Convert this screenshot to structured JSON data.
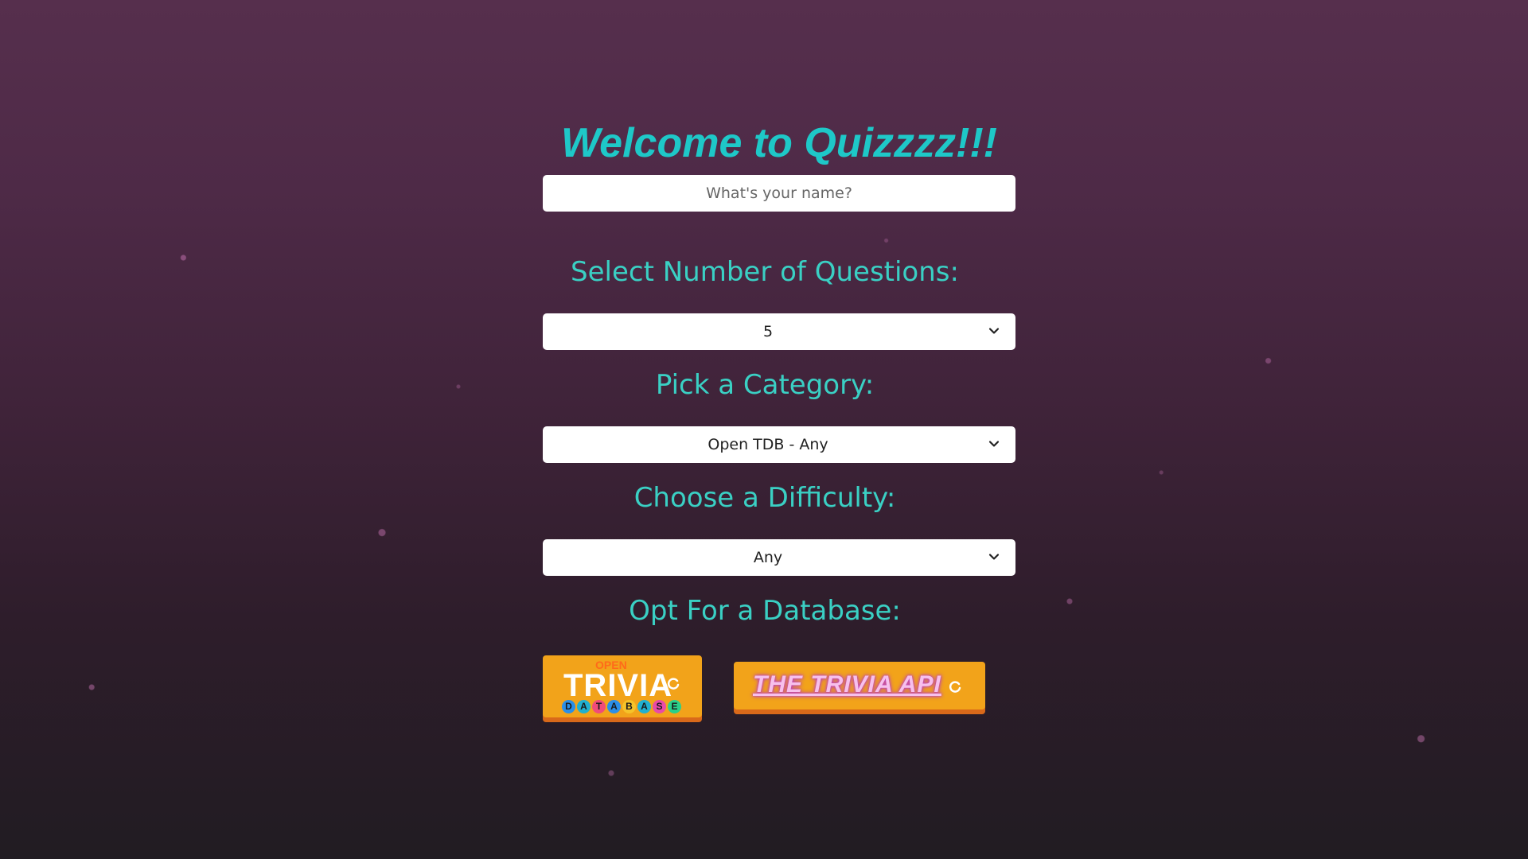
{
  "title": "Welcome to Quizzzz!!!",
  "name_input": {
    "placeholder": "What's your name?",
    "value": ""
  },
  "questions": {
    "label": "Select Number of Questions:",
    "selected": "5"
  },
  "category": {
    "label": "Pick a Category:",
    "selected": "Open TDB - Any"
  },
  "difficulty": {
    "label": "Choose a Difficulty:",
    "selected": "Any"
  },
  "database": {
    "label": "Opt For a Database:",
    "otdb": {
      "top": "OPEN",
      "main": "TRIVIA",
      "letters": [
        "D",
        "A",
        "T",
        "A",
        "B",
        "A",
        "S",
        "E"
      ],
      "letter_colors": [
        "#2a8fe8",
        "#20b0d0",
        "#f04b7a",
        "#2a8fe8",
        "#f5c32a",
        "#20b0d0",
        "#e84aa8",
        "#2ad08a"
      ]
    },
    "api": {
      "text": "THE TRIVIA API"
    }
  },
  "colors": {
    "accent": "#1ec8c8",
    "label": "#3ad0c4",
    "button": "#f2a31a",
    "button_shadow": "#d9691a"
  }
}
